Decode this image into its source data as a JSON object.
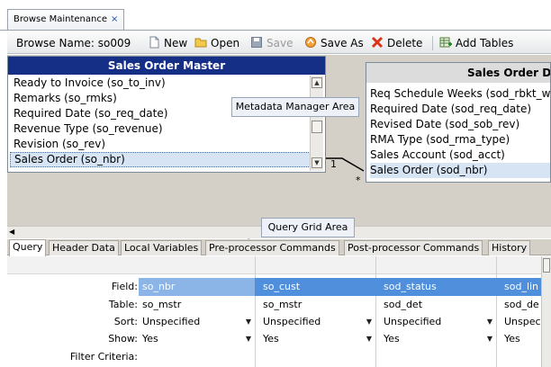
{
  "window": {
    "tab_label": "Browse Maintenance",
    "tab_close": "×"
  },
  "toolbar": {
    "browse_name_label": "Browse Name:",
    "browse_name_value": "so009",
    "new_label": "New",
    "open_label": "Open",
    "save_label": "Save",
    "save_as_label": "Save As",
    "delete_label": "Delete",
    "add_tables_label": "Add Tables"
  },
  "master_table": {
    "title": "Sales Order Master",
    "fields": [
      "Ready to Invoice (so_to_inv)",
      "Remarks (so_rmks)",
      "Required Date (so_req_date)",
      "Revenue Type (so_revenue)",
      "Revision (so_rev)",
      "Sales Order (so_nbr)"
    ],
    "selected_index": 5
  },
  "detail_table": {
    "title": "Sales Order De",
    "fields": [
      "Req Schedule Weeks (sod_rbkt_wee",
      "Required Date (sod_req_date)",
      "Revised Date (sod_sob_rev)",
      "RMA Type (sod_rma_type)",
      "Sales Account (sod_acct)",
      "Sales Order (sod_nbr)"
    ],
    "selected_index": 5
  },
  "join": {
    "one": "1",
    "many": "*"
  },
  "callouts": {
    "metadata": "Metadata Manager Area",
    "query_grid": "Query Grid Area"
  },
  "bottom_tabs": [
    "Query",
    "Header Data",
    "Local Variables",
    "Pre-processor Commands",
    "Post-processor Commands",
    "History"
  ],
  "grid": {
    "row_labels": {
      "field": "Field:",
      "table": "Table:",
      "sort": "Sort:",
      "show": "Show:",
      "filter": "Filter Criteria:"
    },
    "columns": [
      {
        "field": "so_nbr",
        "table": "so_mstr",
        "sort": "Unspecified",
        "show": "Yes"
      },
      {
        "field": "so_cust",
        "table": "so_mstr",
        "sort": "Unspecified",
        "show": "Yes"
      },
      {
        "field": "sod_status",
        "table": "sod_det",
        "sort": "Unspecified",
        "show": "Yes"
      },
      {
        "field": "sod_lin",
        "table": "sod_de",
        "sort": "Unspec",
        "show": "Yes"
      }
    ]
  },
  "colors": {
    "master_title_bg": "#162f86",
    "field_row_bg": "#4f8fdc",
    "workspace_bg": "#d4d0c8"
  }
}
